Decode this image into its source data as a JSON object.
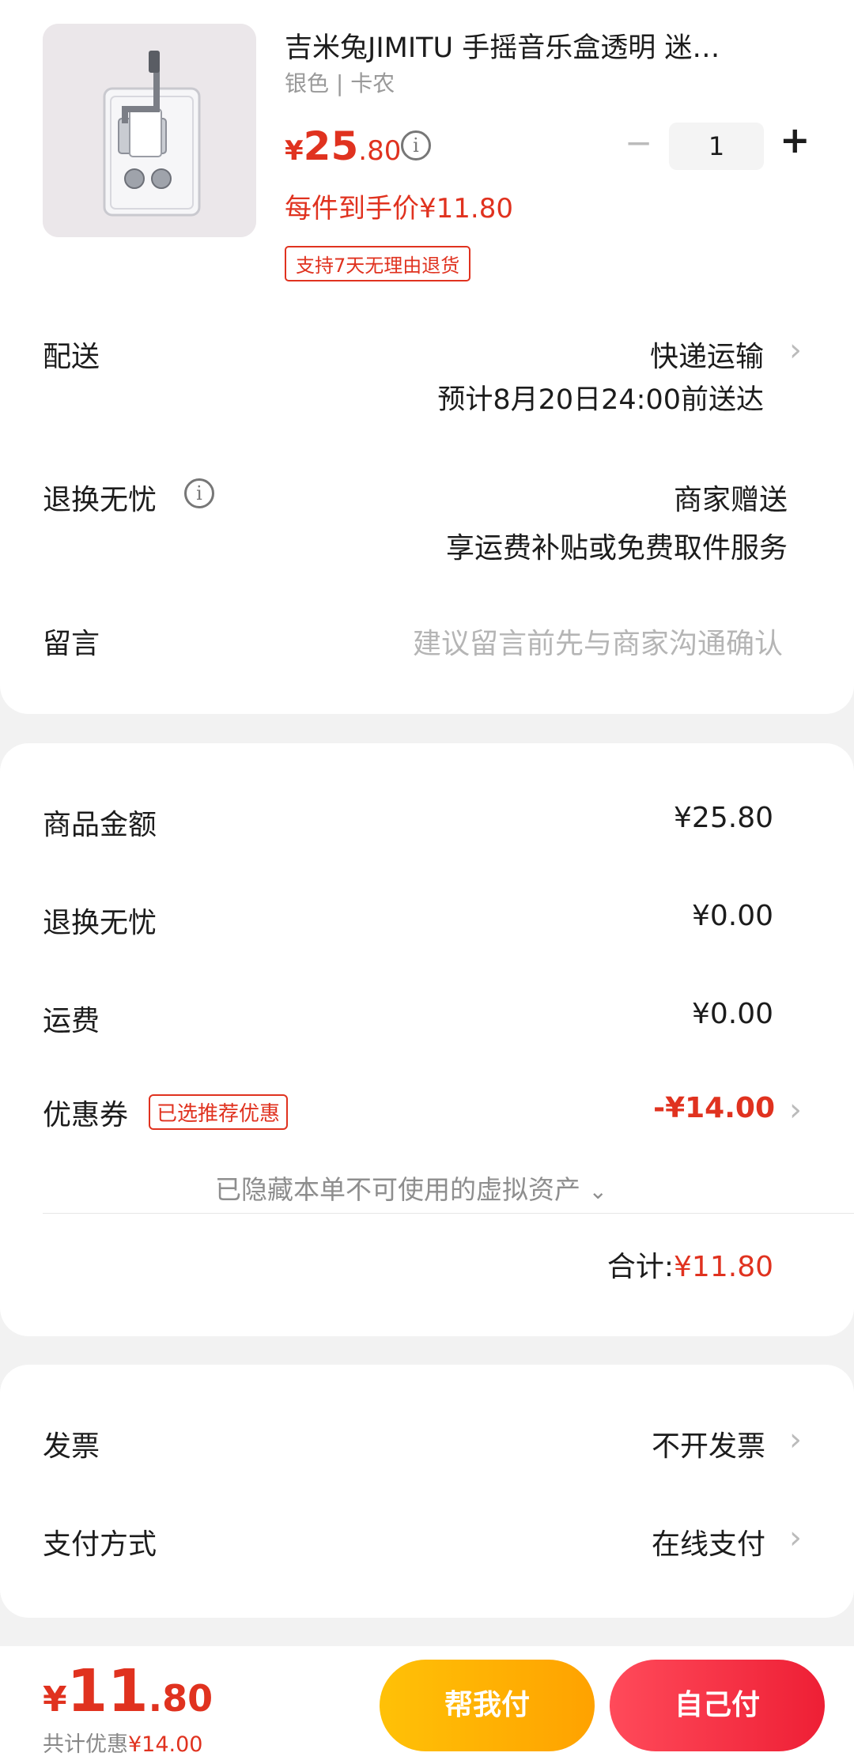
{
  "product": {
    "title": "吉米兔JIMITU  手摇音乐盒透明 迷…",
    "spec": "银色 | 卡农",
    "price_yen": "¥",
    "price_int": "25",
    "price_dec": ".80",
    "info": "i",
    "quantity": "1",
    "qty_minus": "−",
    "qty_plus": "+",
    "deal_price": "每件到手价¥11.80",
    "return_tag": "支持7天无理由退货"
  },
  "delivery": {
    "label": "配送",
    "method": "快递运输",
    "eta": "预计8月20日24:00前送达"
  },
  "worry_free": {
    "label": "退换无忧",
    "info": "i",
    "value": "商家赠送",
    "desc": "享运费补贴或免费取件服务"
  },
  "message": {
    "label": "留言",
    "placeholder": "建议留言前先与商家沟通确认"
  },
  "fees": {
    "goods_label": "商品金额",
    "goods_value": "¥25.80",
    "worry_label": "退换无忧",
    "worry_value": "¥0.00",
    "shipping_label": "运费",
    "shipping_value": "¥0.00",
    "coupon_label": "优惠券",
    "coupon_tag": "已选推荐优惠",
    "coupon_value": "-¥14.00",
    "hidden_assets": "已隐藏本单不可使用的虚拟资产",
    "total_label": "合计:",
    "total_value": "¥11.80"
  },
  "invoice": {
    "label": "发票",
    "value": "不开发票"
  },
  "payment": {
    "label": "支付方式",
    "value": "在线支付"
  },
  "bottom": {
    "yen": "¥",
    "int": "11",
    "dec": ".80",
    "saved_label": "共计优惠",
    "saved_value": "¥14.00",
    "help_pay": "帮我付",
    "self_pay": "自己付"
  },
  "colors": {
    "accent_red": "#e0321f",
    "help_button": "#ffa200",
    "self_button": "#ee1f35"
  },
  "icons": [
    "info-icon",
    "chevron-right-icon",
    "chevron-down-icon",
    "product-thumbnail"
  ]
}
